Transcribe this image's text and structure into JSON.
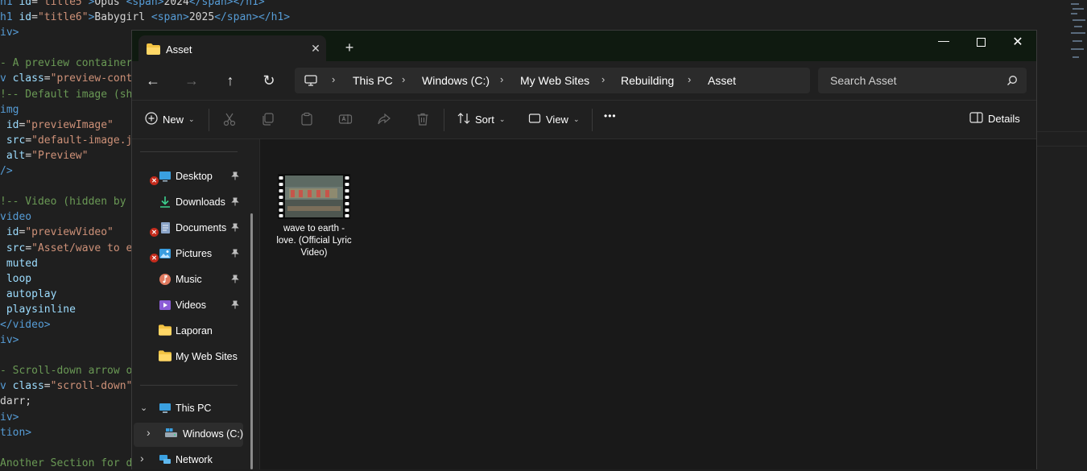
{
  "editor": {
    "lines": [
      {
        "parts": [
          [
            "c-tag",
            "h1 "
          ],
          [
            "c-attr",
            "id"
          ],
          [
            "c-txt",
            "="
          ],
          [
            "c-str",
            "\"title5\""
          ],
          [
            "c-tag",
            ">"
          ],
          [
            "c-txt",
            "Opus "
          ],
          [
            "c-tag",
            "<span>"
          ],
          [
            "c-txt",
            "2024"
          ],
          [
            "c-tag",
            "</span></h1>"
          ]
        ]
      },
      {
        "parts": [
          [
            "c-tag",
            "h1 "
          ],
          [
            "c-attr",
            "id"
          ],
          [
            "c-txt",
            "="
          ],
          [
            "c-str",
            "\"title6\""
          ],
          [
            "c-tag",
            ">"
          ],
          [
            "c-txt",
            "Babygirl "
          ],
          [
            "c-tag",
            "<span>"
          ],
          [
            "c-txt",
            "2025"
          ],
          [
            "c-tag",
            "</span></h1>"
          ]
        ]
      },
      {
        "parts": [
          [
            "c-tag",
            "iv>"
          ]
        ]
      },
      {
        "parts": [
          [
            "c-txt",
            ""
          ]
        ]
      },
      {
        "parts": [
          [
            "c-com",
            "- A preview container"
          ]
        ]
      },
      {
        "parts": [
          [
            "c-tag",
            "v "
          ],
          [
            "c-attr",
            "class"
          ],
          [
            "c-txt",
            "="
          ],
          [
            "c-str",
            "\"preview-cont"
          ]
        ]
      },
      {
        "parts": [
          [
            "c-com",
            "!-- Default image (sh"
          ]
        ]
      },
      {
        "parts": [
          [
            "c-tag",
            "img"
          ]
        ]
      },
      {
        "parts": [
          [
            "c-attr",
            " id"
          ],
          [
            "c-txt",
            "="
          ],
          [
            "c-str",
            "\"previewImage\""
          ]
        ]
      },
      {
        "parts": [
          [
            "c-attr",
            " src"
          ],
          [
            "c-txt",
            "="
          ],
          [
            "c-str",
            "\"default-image.j"
          ]
        ]
      },
      {
        "parts": [
          [
            "c-attr",
            " alt"
          ],
          [
            "c-txt",
            "="
          ],
          [
            "c-str",
            "\"Preview\""
          ]
        ]
      },
      {
        "parts": [
          [
            "c-tag",
            "/>"
          ]
        ]
      },
      {
        "parts": [
          [
            "c-txt",
            ""
          ]
        ]
      },
      {
        "parts": [
          [
            "c-com",
            "!-- Video (hidden by"
          ]
        ]
      },
      {
        "parts": [
          [
            "c-tag",
            "video"
          ]
        ]
      },
      {
        "parts": [
          [
            "c-attr",
            " id"
          ],
          [
            "c-txt",
            "="
          ],
          [
            "c-str",
            "\"previewVideo\""
          ]
        ]
      },
      {
        "parts": [
          [
            "c-attr",
            " src"
          ],
          [
            "c-txt",
            "="
          ],
          [
            "c-str",
            "\"Asset/wave to e"
          ]
        ]
      },
      {
        "parts": [
          [
            "c-attr",
            " muted"
          ]
        ]
      },
      {
        "parts": [
          [
            "c-attr",
            " loop"
          ]
        ]
      },
      {
        "parts": [
          [
            "c-attr",
            " autoplay"
          ]
        ]
      },
      {
        "parts": [
          [
            "c-attr",
            " playsinline"
          ]
        ]
      },
      {
        "parts": [
          [
            "c-tag",
            "</video>"
          ]
        ]
      },
      {
        "parts": [
          [
            "c-tag",
            "iv>"
          ]
        ]
      },
      {
        "parts": [
          [
            "c-txt",
            ""
          ]
        ]
      },
      {
        "parts": [
          [
            "c-com",
            "- Scroll-down arrow o"
          ]
        ]
      },
      {
        "parts": [
          [
            "c-tag",
            "v "
          ],
          [
            "c-attr",
            "class"
          ],
          [
            "c-txt",
            "="
          ],
          [
            "c-str",
            "\"scroll-down\""
          ]
        ]
      },
      {
        "parts": [
          [
            "c-txt",
            "darr;"
          ]
        ]
      },
      {
        "parts": [
          [
            "c-tag",
            "iv>"
          ]
        ]
      },
      {
        "parts": [
          [
            "c-tag",
            "tion>"
          ]
        ]
      },
      {
        "parts": [
          [
            "c-txt",
            ""
          ]
        ]
      },
      {
        "parts": [
          [
            "c-com",
            "Another Section for d"
          ]
        ]
      }
    ]
  },
  "window": {
    "tab_title": "Asset",
    "close_tab_glyph": "✕",
    "new_tab_glyph": "+",
    "minimize_glyph": "—",
    "close_glyph": "✕"
  },
  "address": {
    "back_glyph": "←",
    "forward_glyph": "→",
    "up_glyph": "↑",
    "refresh_glyph": "↻",
    "crumbs": [
      "This PC",
      "Windows (C:)",
      "My Web Sites",
      "Rebuilding",
      "Asset"
    ],
    "sep_glyph": "›",
    "search_placeholder": "Search Asset"
  },
  "toolbar": {
    "new_label": "New",
    "sort_label": "Sort",
    "view_label": "View",
    "more_label": "•••",
    "details_label": "Details",
    "chevron": "⌄"
  },
  "nav": {
    "items": [
      {
        "label": "Desktop",
        "icon": "desktop-icon",
        "pinned": true,
        "error": true
      },
      {
        "label": "Downloads",
        "icon": "downloads-icon",
        "pinned": true,
        "error": false
      },
      {
        "label": "Documents",
        "icon": "documents-icon",
        "pinned": true,
        "error": true
      },
      {
        "label": "Pictures",
        "icon": "pictures-icon",
        "pinned": true,
        "error": true
      },
      {
        "label": "Music",
        "icon": "music-icon",
        "pinned": true,
        "error": false
      },
      {
        "label": "Videos",
        "icon": "videos-icon",
        "pinned": true,
        "error": false
      },
      {
        "label": "Laporan",
        "icon": "folder-icon",
        "pinned": false,
        "error": false
      },
      {
        "label": "My Web Sites",
        "icon": "folder-icon",
        "pinned": false,
        "error": false
      }
    ],
    "this_pc": "This PC",
    "windows_c": "Windows (C:)",
    "network": "Network",
    "pin_glyph": "📌",
    "err_glyph": "✕",
    "expand_down": "⌄",
    "expand_right": "›"
  },
  "files": [
    {
      "name": "wave to earth - love. (Official Lyric Video)"
    }
  ],
  "colors": {
    "accent": "#60cdff",
    "folder": "#f3c343",
    "error": "#c42b1c"
  }
}
